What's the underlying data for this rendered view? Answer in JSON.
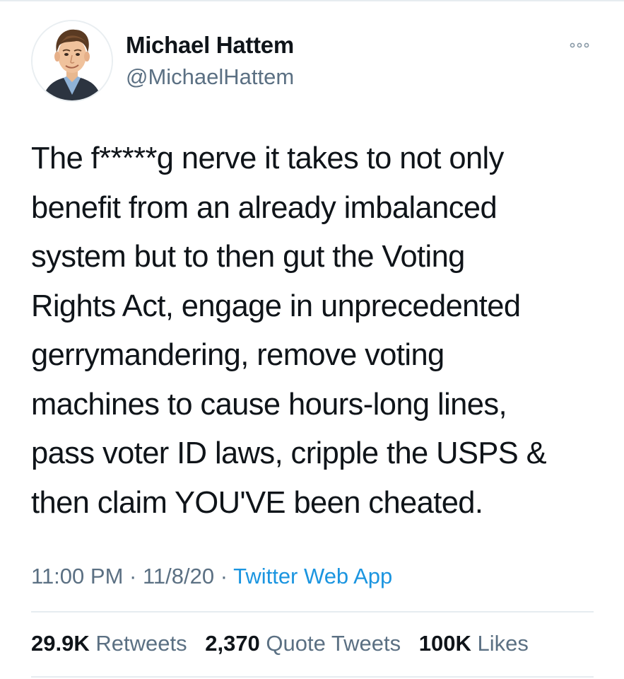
{
  "author": {
    "display_name": "Michael Hattem",
    "handle": "@MichaelHattem",
    "avatar_icon": "caricature-avatar"
  },
  "more_icon": "ellipsis-icon",
  "tweet": {
    "lines": [
      "The f*****g nerve it takes to not only",
      "benefit from an already imbalanced",
      "system but to then gut the Voting",
      "Rights Act, engage in unprecedented",
      "gerrymandering, remove voting",
      "machines to cause hours-long lines,",
      "pass voter ID laws, cripple the USPS &",
      "then claim YOU'VE been cheated."
    ]
  },
  "meta": {
    "time": "11:00 PM",
    "sep1": " · ",
    "date": "11/8/20",
    "sep2": " · ",
    "source": "Twitter Web App"
  },
  "stats": {
    "retweets": {
      "count": "29.9K",
      "label": "Retweets"
    },
    "quotes": {
      "count": "2,370",
      "label": "Quote Tweets"
    },
    "likes": {
      "count": "100K",
      "label": "Likes"
    }
  },
  "colors": {
    "text": "#0f1419",
    "secondary": "#5b7083",
    "link": "#1b95e0",
    "divider": "#e6ecf0"
  }
}
